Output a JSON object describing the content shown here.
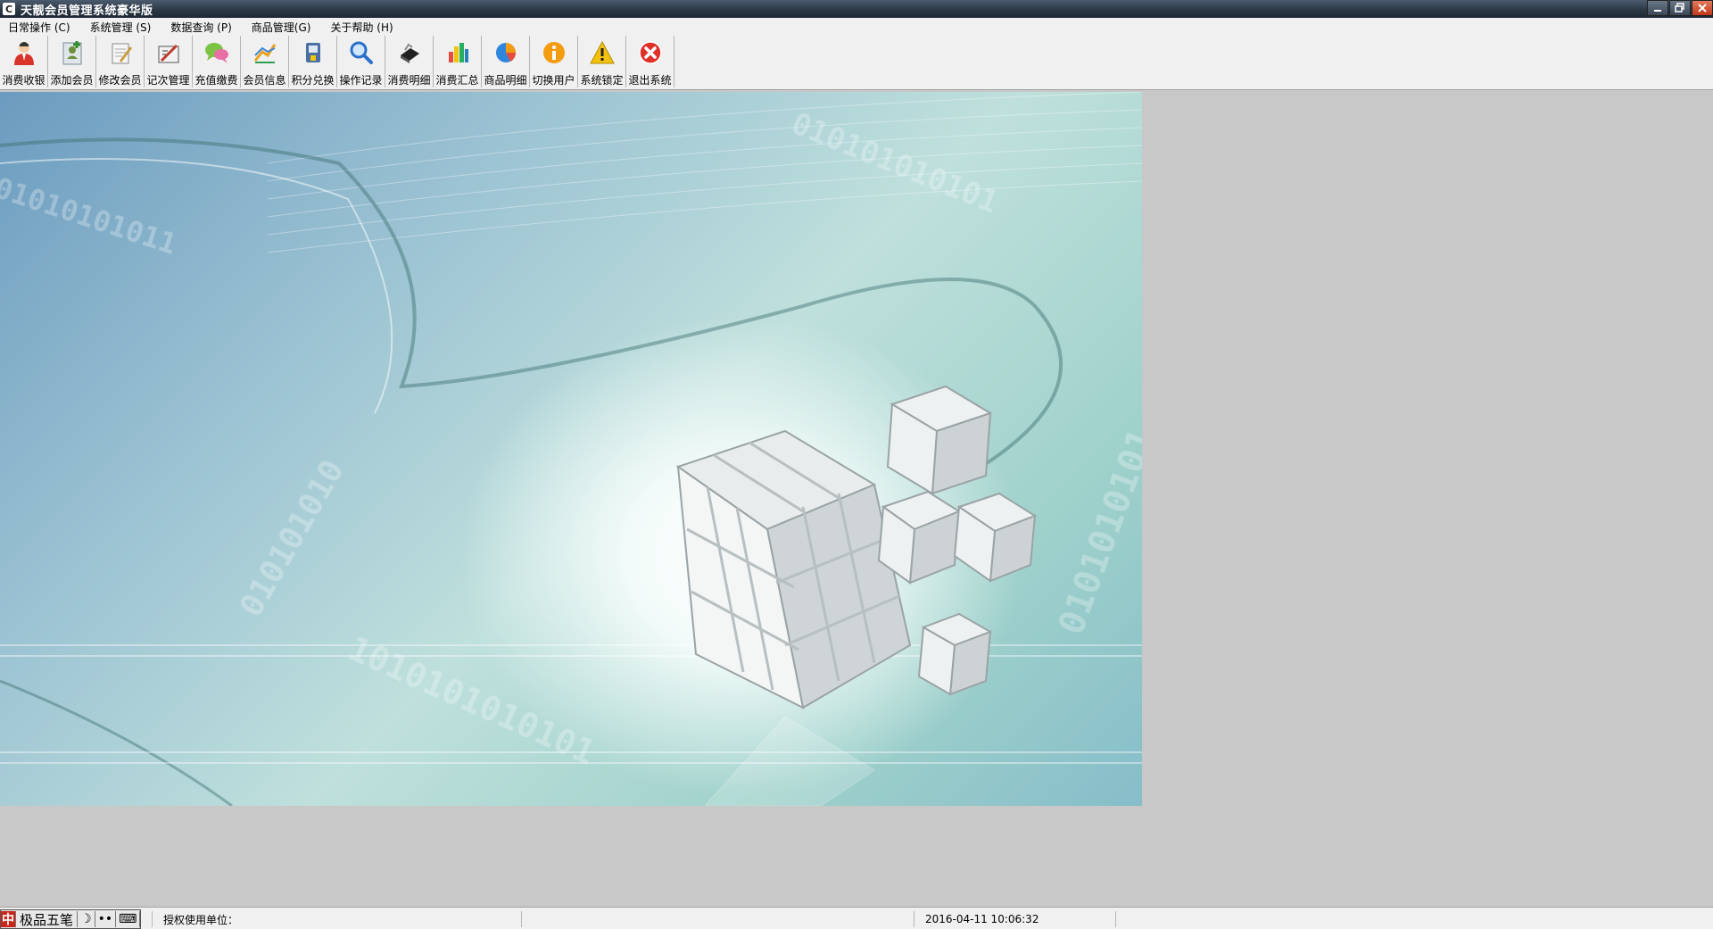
{
  "window": {
    "title": "天靓会员管理系统豪华版",
    "buttons": [
      "minimize",
      "restore",
      "close"
    ]
  },
  "menu": [
    {
      "label": "日常操作 (C)"
    },
    {
      "label": "系统管理 (S)"
    },
    {
      "label": "数据查询 (P)"
    },
    {
      "label": "商品管理(G)"
    },
    {
      "label": "关于帮助 (H)"
    }
  ],
  "toolbar": [
    {
      "label": "消费收银",
      "icon": "cashier-person-icon"
    },
    {
      "label": "添加会员",
      "icon": "add-member-icon"
    },
    {
      "label": "修改会员",
      "icon": "edit-member-icon"
    },
    {
      "label": "记次管理",
      "icon": "count-manage-icon"
    },
    {
      "label": "充值缴费",
      "icon": "recharge-chat-icon"
    },
    {
      "label": "会员信息",
      "icon": "member-info-icon"
    },
    {
      "label": "积分兑换",
      "icon": "points-exchange-icon"
    },
    {
      "label": "操作记录",
      "icon": "magnifier-icon"
    },
    {
      "label": "消费明细",
      "icon": "consumption-detail-icon"
    },
    {
      "label": "消费汇总",
      "icon": "bar-chart-icon"
    },
    {
      "label": "商品明细",
      "icon": "pie-chart-icon"
    },
    {
      "label": "切换用户",
      "icon": "info-icon"
    },
    {
      "label": "系统锁定",
      "icon": "warning-icon"
    },
    {
      "label": "退出系统",
      "icon": "exit-icon"
    }
  ],
  "ime": {
    "logo": "中",
    "name": "极品五笔",
    "moon": "☽",
    "dots": "••",
    "keyboard": "⌨"
  },
  "status": {
    "license_label": "授权使用单位：",
    "datetime": "2016-04-11 10:06:32"
  },
  "colors": {
    "titlebar": "#2c3846",
    "menu_bg": "#f0f0f0",
    "workspace_bg": "#c8c8c8",
    "banner_teal": "#9fd1cb",
    "banner_blue": "#6b9bbf"
  }
}
